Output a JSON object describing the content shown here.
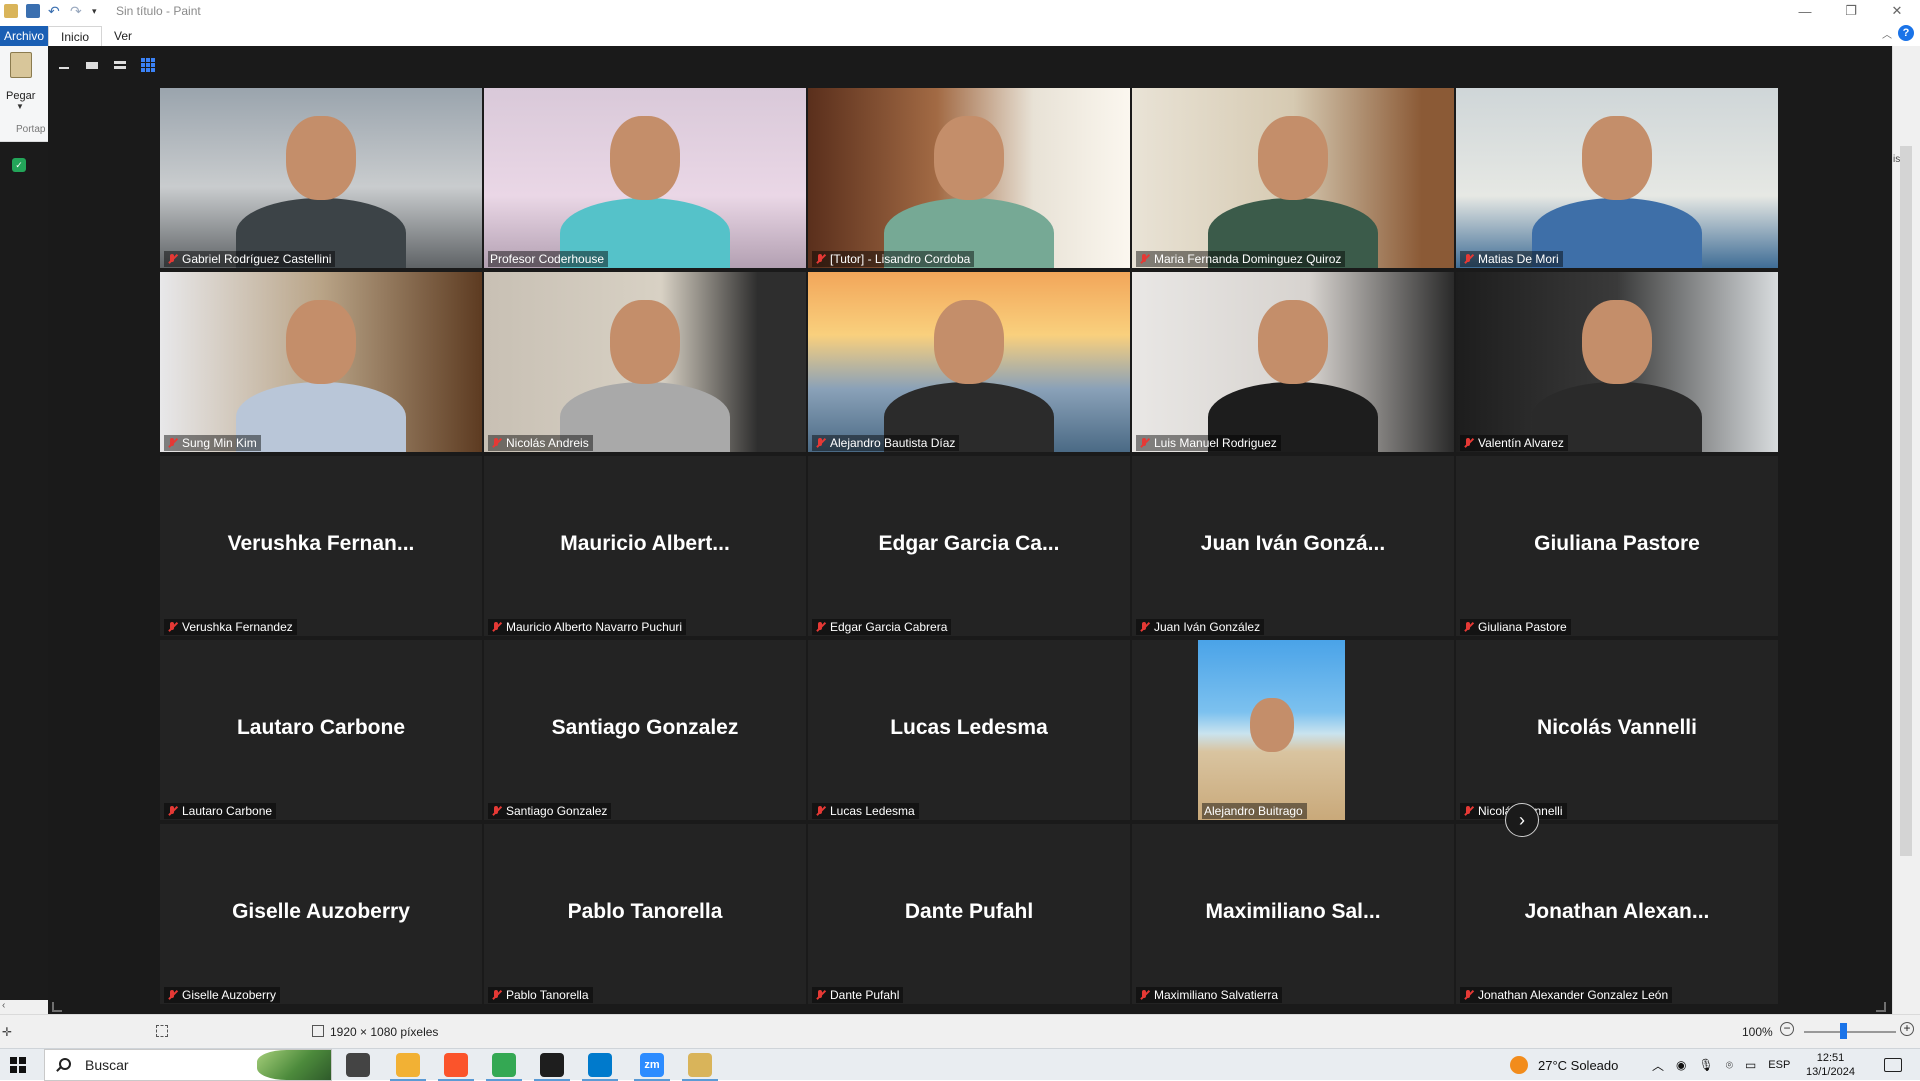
{
  "paint": {
    "window_title": "Sin título - Paint",
    "tabs": [
      {
        "label": "Archivo"
      },
      {
        "label": "Inicio"
      },
      {
        "label": "Ver"
      }
    ],
    "paste_label": "Pegar",
    "clipboard_group": "Portap",
    "side_text": "ist",
    "status": {
      "dimensions": "1920 × 1080 píxeles",
      "zoom": "100%"
    }
  },
  "zoom": {
    "next_page_glyph": "›",
    "tiles": [
      {
        "kind": "video",
        "label": "Gabriel Rodríguez Castellini",
        "muted": true
      },
      {
        "kind": "video",
        "label": "Profesor Coderhouse",
        "muted": false
      },
      {
        "kind": "video",
        "label": "[Tutor] - Lisandro Cordoba",
        "muted": true,
        "active": true
      },
      {
        "kind": "video",
        "label": "Maria Fernanda Dominguez Quiroz",
        "muted": true
      },
      {
        "kind": "video",
        "label": "Matias De Mori",
        "muted": true
      },
      {
        "kind": "video",
        "label": "Sung Min Kim",
        "muted": true
      },
      {
        "kind": "video",
        "label": "Nicolás Andreis",
        "muted": true
      },
      {
        "kind": "video",
        "label": "Alejandro Bautista Díaz",
        "muted": true
      },
      {
        "kind": "video",
        "label": "Luis Manuel Rodriguez",
        "muted": true
      },
      {
        "kind": "video",
        "label": "Valentín Alvarez",
        "muted": true
      },
      {
        "kind": "name",
        "display": "Verushka  Fernan...",
        "label": "Verushka Fernandez",
        "muted": true
      },
      {
        "kind": "name",
        "display": "Mauricio  Albert...",
        "label": "Mauricio Alberto Navarro Puchuri",
        "muted": true
      },
      {
        "kind": "name",
        "display": "Edgar Garcia Ca...",
        "label": "Edgar Garcia Cabrera",
        "muted": true
      },
      {
        "kind": "name",
        "display": "Juan Iván Gonzá...",
        "label": "Juan Iván González",
        "muted": true
      },
      {
        "kind": "name",
        "display": "Giuliana Pastore",
        "label": "Giuliana Pastore",
        "muted": true
      },
      {
        "kind": "name",
        "display": "Lautaro Carbone",
        "label": "Lautaro Carbone",
        "muted": true
      },
      {
        "kind": "name",
        "display": "Santiago Gonzalez",
        "label": "Santiago Gonzalez",
        "muted": true
      },
      {
        "kind": "name",
        "display": "Lucas Ledesma",
        "label": "Lucas Ledesma",
        "muted": true
      },
      {
        "kind": "photo",
        "label": "Alejandro Buitrago",
        "muted": false
      },
      {
        "kind": "name",
        "display": "Nicolás Vannelli",
        "label": "Nicolás Vannelli",
        "muted": true
      },
      {
        "kind": "name",
        "display": "Giselle Auzoberry",
        "label": "Giselle Auzoberry",
        "muted": true
      },
      {
        "kind": "name",
        "display": "Pablo Tanorella",
        "label": "Pablo Tanorella",
        "muted": true
      },
      {
        "kind": "name",
        "display": "Dante Pufahl",
        "label": "Dante Pufahl",
        "muted": true
      },
      {
        "kind": "name",
        "display": "Maximiliano  Sal...",
        "label": "Maximiliano Salvatierra",
        "muted": true
      },
      {
        "kind": "name",
        "display": "Jonathan  Alexan...",
        "label": "Jonathan Alexander Gonzalez León",
        "muted": true
      }
    ]
  },
  "taskbar": {
    "search_placeholder": "Buscar",
    "weather": "27°C  Soleado",
    "language": "ESP",
    "time": "12:51",
    "date": "13/1/2024",
    "apps": [
      {
        "name": "task-view-icon",
        "color": "#444444"
      },
      {
        "name": "file-explorer-icon",
        "color": "#f2b134"
      },
      {
        "name": "brave-browser-icon",
        "color": "#fb542b"
      },
      {
        "name": "chrome-icon",
        "color": "#34a853"
      },
      {
        "name": "terminal-icon",
        "color": "#1e1e1e"
      },
      {
        "name": "vscode-icon",
        "color": "#007acc"
      },
      {
        "name": "zoom-app-icon",
        "color": "#2d8cff",
        "text": "zm"
      },
      {
        "name": "paint-icon",
        "color": "#d9b45a"
      }
    ]
  },
  "colors": {
    "zoom_background": "#1a1a1a",
    "tile_background": "#232323",
    "muted_red": "#e53935",
    "active_outline": "#e0e070",
    "accent_blue": "#1a5fb4"
  }
}
